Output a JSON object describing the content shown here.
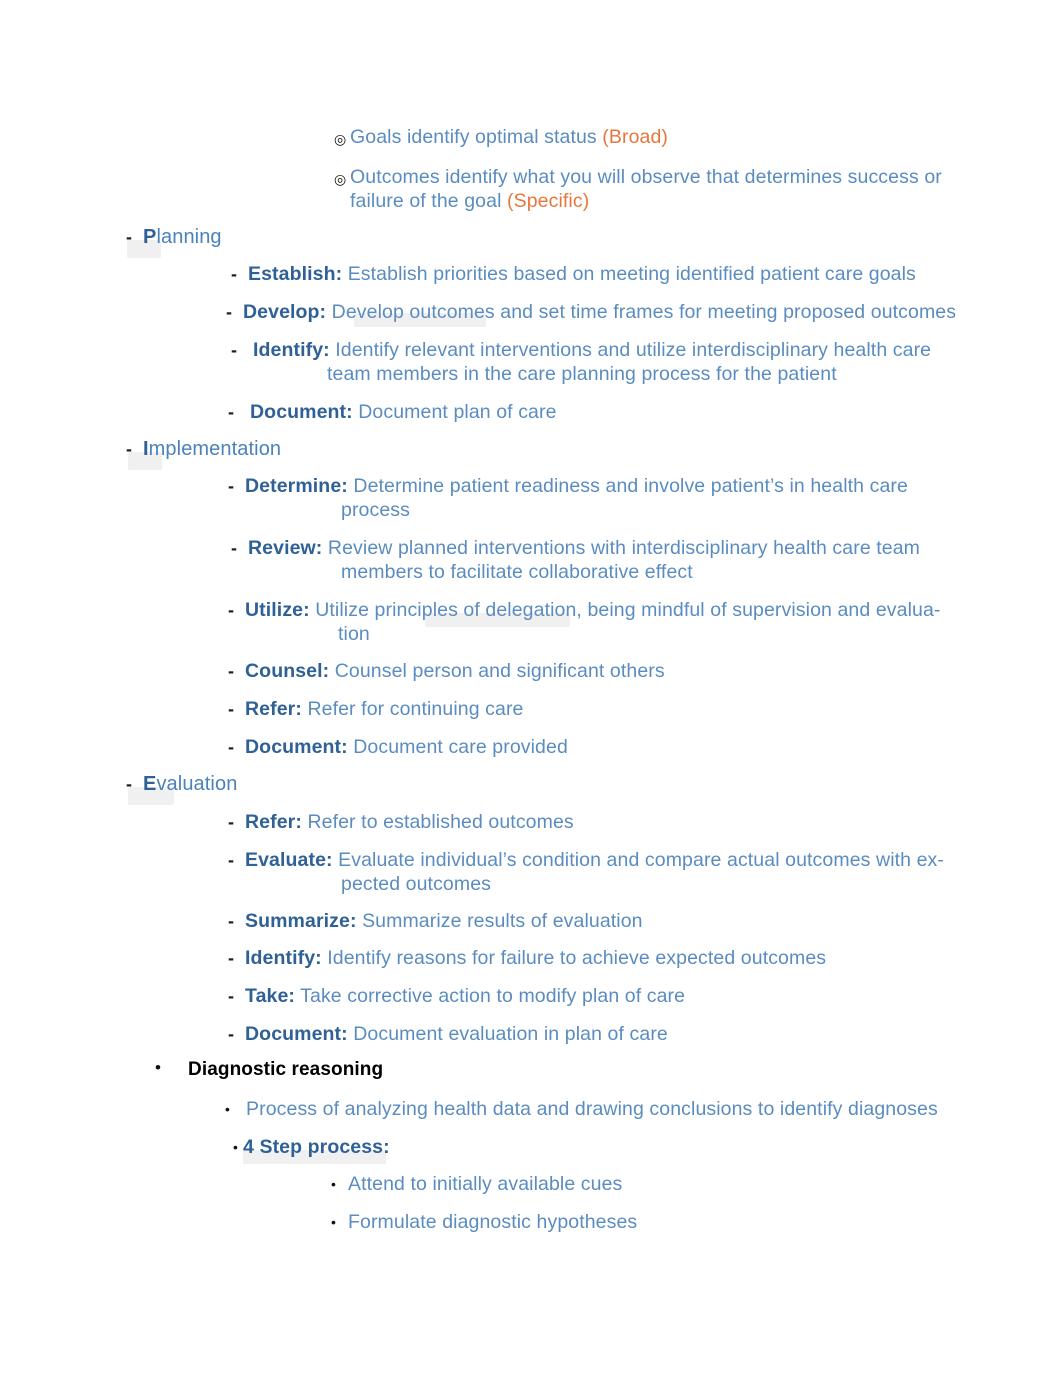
{
  "document": {
    "page_background": "#ffffff",
    "text_color": "#5a8cc0",
    "label_color": "#2f6196",
    "accent_color": "#e8763c",
    "black_color": "#000000"
  },
  "markers": {
    "bullseye": "◎",
    "dash": "-",
    "dot": "•"
  },
  "outcomes": {
    "goals": {
      "text": "Goals identify optimal status ",
      "accent": "(Broad)"
    },
    "outcomes": {
      "line1": "Outcomes identify what you will observe that determines success or",
      "line2": "failure of the goal ",
      "accent": "(Specific)"
    }
  },
  "planning": {
    "heading_first_letter": "P",
    "heading_rest": "lanning",
    "items": [
      {
        "label": "Establish:",
        "text": " Establish priorities based on meeting identified patient care goals"
      },
      {
        "label": "Develop:",
        "text": " Develop outcomes and set time frames for meeting proposed outcomes"
      },
      {
        "label": "Identify:",
        "text": " Identify relevant interventions and utilize interdisciplinary health care",
        "text2": "team members in the care planning process for the patient"
      },
      {
        "label": "Document:",
        "text": " Document plan of care"
      }
    ]
  },
  "implementation": {
    "heading_first_letter": "I",
    "heading_rest": "mplementation",
    "items": [
      {
        "label": "Determine:",
        "text": " Determine patient readiness and involve patient’s in health care",
        "text2": "process"
      },
      {
        "label": "Review:",
        "text": " Review planned interventions with interdisciplinary health care team",
        "text2": "members to facilitate collaborative effect"
      },
      {
        "label": "Utilize:",
        "text": " Utilize principles of delegation, being mindful of supervision and evalua-",
        "text2": "tion"
      },
      {
        "label": "Counsel:",
        "text": " Counsel person and significant others"
      },
      {
        "label": "Refer:",
        "text": " Refer for continuing care"
      },
      {
        "label": "Document:",
        "text": " Document care provided"
      }
    ]
  },
  "evaluation": {
    "heading_first_letter": "E",
    "heading_rest": "valuation",
    "items": [
      {
        "label": "Refer:",
        "text": " Refer to established outcomes"
      },
      {
        "label": "Evaluate:",
        "text": " Evaluate individual’s condition and compare actual outcomes with ex-",
        "text2": "pected outcomes"
      },
      {
        "label": "Summarize:",
        "text": " Summarize results of evaluation"
      },
      {
        "label": "Identify:",
        "text": " Identify reasons for failure to achieve expected outcomes"
      },
      {
        "label": "Take:",
        "text": " Take corrective action to modify plan of care"
      },
      {
        "label": "Document:",
        "text": " Document evaluation in plan of care"
      }
    ]
  },
  "diagnostic_reasoning": {
    "heading": "Diagnostic reasoning",
    "description": " Process of analyzing health data and drawing conclusions to identify diagnoses",
    "process_label": "4 Step process:",
    "steps": [
      "Attend to initially available cues",
      "Formulate diagnostic hypotheses"
    ]
  }
}
